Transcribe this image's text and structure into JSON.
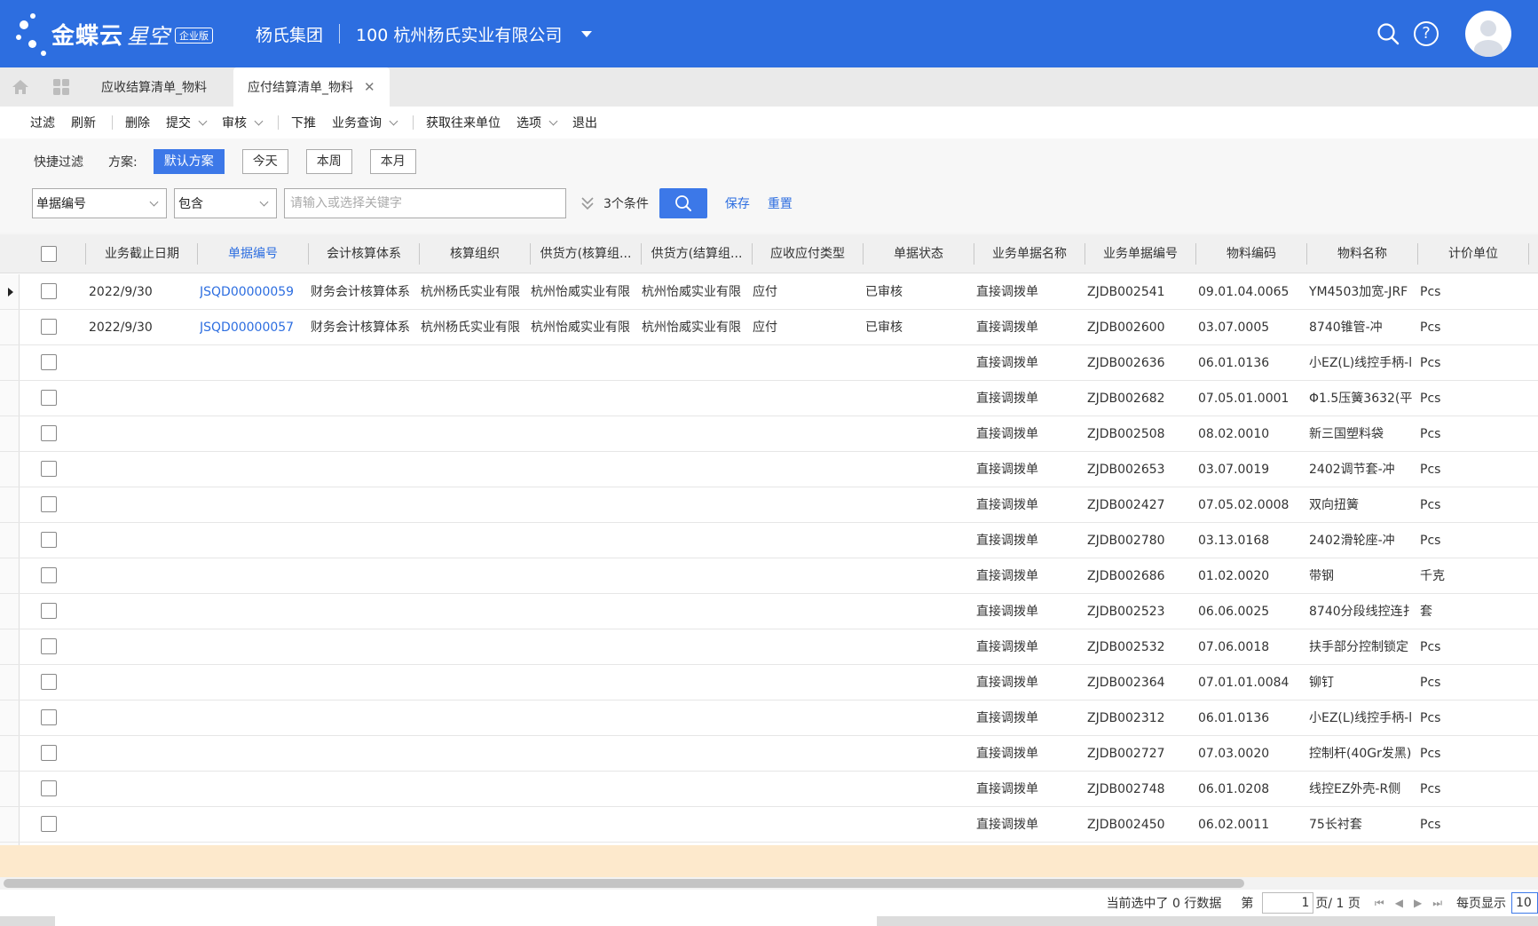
{
  "header": {
    "logo_text": "金蝶云",
    "logo_text2": "星空",
    "logo_badge": "企业版",
    "org": "杨氏集团",
    "company": "100  杭州杨氏实业有限公司"
  },
  "tabs": [
    {
      "label": "应收结算清单_物料"
    },
    {
      "label": "应付结算清单_物料"
    }
  ],
  "toolbar": {
    "filter": "过滤",
    "refresh": "刷新",
    "delete": "删除",
    "submit": "提交",
    "audit": "审核",
    "push_down": "下推",
    "biz_query": "业务查询",
    "get_partner": "获取往来单位",
    "options": "选项",
    "exit": "退出"
  },
  "filter": {
    "quick_filter": "快捷过滤",
    "plan_label": "方案:",
    "chips": [
      "默认方案",
      "今天",
      "本周",
      "本月"
    ],
    "field_select": "单据编号",
    "op_select": "包含",
    "keyword_placeholder": "请输入或选择关键字",
    "conditions": "3个条件",
    "save": "保存",
    "reset": "重置"
  },
  "columns": [
    "业务截止日期",
    "单据编号",
    "会计核算体系",
    "核算组织",
    "供货方(核算组...",
    "供货方(结算组...",
    "应收应付类型",
    "单据状态",
    "业务单据名称",
    "业务单据编号",
    "物料编码",
    "物料名称",
    "计价单位"
  ],
  "rows": [
    {
      "date": "2022/9/30",
      "bill_no": "JSQD00000059",
      "acct_sys": "财务会计核算体系",
      "acct_org": "杭州杨氏实业有限",
      "sup1": "杭州怡威实业有限",
      "sup2": "杭州怡威实业有限",
      "type": "应付",
      "status": "已审核",
      "biz_name": "直接调拨单",
      "biz_no": "ZJDB002541",
      "mat_code": "09.01.04.0065",
      "mat_name": "YM4503加宽-JRF",
      "unit": "Pcs"
    },
    {
      "date": "2022/9/30",
      "bill_no": "JSQD00000057",
      "acct_sys": "财务会计核算体系",
      "acct_org": "杭州杨氏实业有限",
      "sup1": "杭州怡威实业有限",
      "sup2": "杭州怡威实业有限",
      "type": "应付",
      "status": "已审核",
      "biz_name": "直接调拨单",
      "biz_no": "ZJDB002600",
      "mat_code": "03.07.0005",
      "mat_name": "8740锥管-冲",
      "unit": "Pcs"
    },
    {
      "date": "",
      "bill_no": "",
      "acct_sys": "",
      "acct_org": "",
      "sup1": "",
      "sup2": "",
      "type": "",
      "status": "",
      "biz_name": "直接调拨单",
      "biz_no": "ZJDB002636",
      "mat_code": "06.01.0136",
      "mat_name": "小EZ(L)线控手柄-l",
      "unit": "Pcs"
    },
    {
      "date": "",
      "bill_no": "",
      "acct_sys": "",
      "acct_org": "",
      "sup1": "",
      "sup2": "",
      "type": "",
      "status": "",
      "biz_name": "直接调拨单",
      "biz_no": "ZJDB002682",
      "mat_code": "07.05.01.0001",
      "mat_name": "Φ1.5压簧3632(平",
      "unit": "Pcs"
    },
    {
      "date": "",
      "bill_no": "",
      "acct_sys": "",
      "acct_org": "",
      "sup1": "",
      "sup2": "",
      "type": "",
      "status": "",
      "biz_name": "直接调拨单",
      "biz_no": "ZJDB002508",
      "mat_code": "08.02.0010",
      "mat_name": "新三国塑料袋",
      "unit": "Pcs"
    },
    {
      "date": "",
      "bill_no": "",
      "acct_sys": "",
      "acct_org": "",
      "sup1": "",
      "sup2": "",
      "type": "",
      "status": "",
      "biz_name": "直接调拨单",
      "biz_no": "ZJDB002653",
      "mat_code": "03.07.0019",
      "mat_name": "2402调节套-冲",
      "unit": "Pcs"
    },
    {
      "date": "",
      "bill_no": "",
      "acct_sys": "",
      "acct_org": "",
      "sup1": "",
      "sup2": "",
      "type": "",
      "status": "",
      "biz_name": "直接调拨单",
      "biz_no": "ZJDB002427",
      "mat_code": "07.05.02.0008",
      "mat_name": "双向扭簧",
      "unit": "Pcs"
    },
    {
      "date": "",
      "bill_no": "",
      "acct_sys": "",
      "acct_org": "",
      "sup1": "",
      "sup2": "",
      "type": "",
      "status": "",
      "biz_name": "直接调拨单",
      "biz_no": "ZJDB002780",
      "mat_code": "03.13.0168",
      "mat_name": "2402滑轮座-冲",
      "unit": "Pcs"
    },
    {
      "date": "",
      "bill_no": "",
      "acct_sys": "",
      "acct_org": "",
      "sup1": "",
      "sup2": "",
      "type": "",
      "status": "",
      "biz_name": "直接调拨单",
      "biz_no": "ZJDB002686",
      "mat_code": "01.02.0020",
      "mat_name": "带钢",
      "unit": "千克"
    },
    {
      "date": "",
      "bill_no": "",
      "acct_sys": "",
      "acct_org": "",
      "sup1": "",
      "sup2": "",
      "type": "",
      "status": "",
      "biz_name": "直接调拨单",
      "biz_no": "ZJDB002523",
      "mat_code": "06.06.0025",
      "mat_name": "8740分段线控连扌",
      "unit": "套"
    },
    {
      "date": "",
      "bill_no": "",
      "acct_sys": "",
      "acct_org": "",
      "sup1": "",
      "sup2": "",
      "type": "",
      "status": "",
      "biz_name": "直接调拨单",
      "biz_no": "ZJDB002532",
      "mat_code": "07.06.0018",
      "mat_name": "扶手部分控制锁定",
      "unit": "Pcs"
    },
    {
      "date": "",
      "bill_no": "",
      "acct_sys": "",
      "acct_org": "",
      "sup1": "",
      "sup2": "",
      "type": "",
      "status": "",
      "biz_name": "直接调拨单",
      "biz_no": "ZJDB002364",
      "mat_code": "07.01.01.0084",
      "mat_name": "铆钉",
      "unit": "Pcs"
    },
    {
      "date": "",
      "bill_no": "",
      "acct_sys": "",
      "acct_org": "",
      "sup1": "",
      "sup2": "",
      "type": "",
      "status": "",
      "biz_name": "直接调拨单",
      "biz_no": "ZJDB002312",
      "mat_code": "06.01.0136",
      "mat_name": "小EZ(L)线控手柄-l",
      "unit": "Pcs"
    },
    {
      "date": "",
      "bill_no": "",
      "acct_sys": "",
      "acct_org": "",
      "sup1": "",
      "sup2": "",
      "type": "",
      "status": "",
      "biz_name": "直接调拨单",
      "biz_no": "ZJDB002727",
      "mat_code": "07.03.0020",
      "mat_name": "控制杆(40Gr发黑)",
      "unit": "Pcs"
    },
    {
      "date": "",
      "bill_no": "",
      "acct_sys": "",
      "acct_org": "",
      "sup1": "",
      "sup2": "",
      "type": "",
      "status": "",
      "biz_name": "直接调拨单",
      "biz_no": "ZJDB002748",
      "mat_code": "06.01.0208",
      "mat_name": "线控EZ外壳-R侧",
      "unit": "Pcs"
    },
    {
      "date": "",
      "bill_no": "",
      "acct_sys": "",
      "acct_org": "",
      "sup1": "",
      "sup2": "",
      "type": "",
      "status": "",
      "biz_name": "直接调拨单",
      "biz_no": "ZJDB002450",
      "mat_code": "06.02.0011",
      "mat_name": "75长衬套",
      "unit": "Pcs"
    }
  ],
  "pager": {
    "selected_info": "当前选中了 0 行数据",
    "page_prefix": "第",
    "page_current": "1",
    "page_suffix": "页/ 1 页",
    "per_page_label": "每页显示",
    "per_page_value": "10"
  }
}
